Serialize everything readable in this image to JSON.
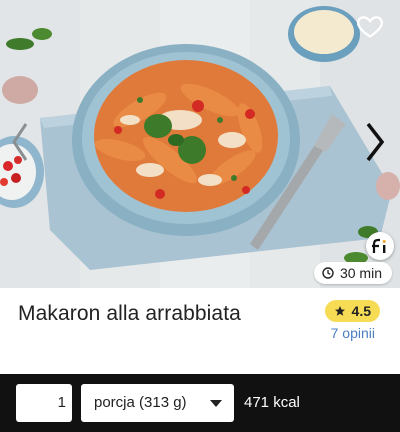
{
  "recipe": {
    "title": "Makaron alla arrabbiata",
    "cook_time": "30 min",
    "rating": "4.5",
    "opinions": "7 opinii",
    "image_alt": "pasta-dish-photo"
  },
  "icons": {
    "favorite": "heart-outline-icon",
    "prev": "chevron-left-icon",
    "next": "chevron-right-icon",
    "brand": "fi-logo-icon",
    "clock": "clock-icon",
    "star": "star-icon"
  },
  "nutrition_bar": {
    "quantity": "1",
    "portion": "porcja (313 g)",
    "kcal": "471 kcal"
  },
  "colors": {
    "rating_badge": "#f6dc55",
    "opinions_link": "#4a7fc0",
    "bar_background": "#111111"
  }
}
